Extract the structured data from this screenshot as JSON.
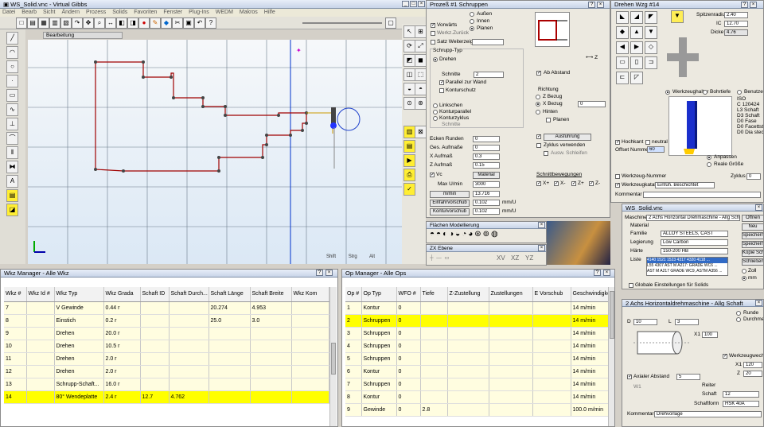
{
  "app": {
    "title": "WS_Solid.vnc - Virtual Gibbs"
  },
  "menu": [
    "Datei",
    "Bearb",
    "Sicht",
    "Ändern",
    "Prozess",
    "Solids",
    "Favoriten",
    "Fenster",
    "Plug-Ins",
    "WEDM",
    "Makros",
    "Hilfe"
  ],
  "viewport": {
    "tab": "Bearbeitung",
    "footer": [
      "Shift",
      "Strg",
      "Alt"
    ]
  },
  "process": {
    "title": "Prozeß #1 Schruppen",
    "options_top": [
      "Vorwärts",
      "Werkz.Zurück",
      "Satz Weiterzeigung"
    ],
    "outer_inner": [
      "Außen",
      "Innen",
      "Planen"
    ],
    "group_title": "Schrupp-Typ",
    "typ": "Drehen",
    "schnitte_label": "Schnitte",
    "schnitte": "2",
    "profile_check": "Parallel zur Wand",
    "kontur_check": "Konturschutz",
    "lists": [
      "Linkschen",
      "Konturparallel",
      "Konturzyklus"
    ],
    "schnitte2": "Schnitte",
    "abstand_label": "Ab Abstand",
    "richtung": "Richtung",
    "richtung_opts": [
      "Z Bezug",
      "X Bezug"
    ],
    "fixiert_label": "Fixiert bei",
    "fixiert": "0",
    "hinter": "Hinten",
    "planen": "Planen",
    "ecken_label": "Ecken Runden",
    "ecken": "0",
    "aufmass_label": "Ges. Aufmaße",
    "aufmass": "0",
    "x_aufmass_label": "X Aufmaß",
    "x_aufmass": "0.3",
    "z_aufmass_label": "Z Aufmaß",
    "z_aufmass": "0.15",
    "vc_label": "Vc",
    "material_btn": "Material",
    "max_label": "Max U/min",
    "max_val": "3000",
    "rpm_btn": "m/min",
    "rpm_val": "13.716",
    "einfahr_btn": "Einfahrvorschub",
    "einfahr_val": "0.102",
    "einfahr_unit": "mm/U",
    "kontur_btn": "Konturvorschub",
    "kontur_val": "0.102",
    "kontur_unit": "mm/U",
    "ausfahr_label": "Ausführung",
    "checks_right": [
      "Zyklus verwenden",
      "Ausw. Schleifen"
    ],
    "schnitt_opts": "Schnittbewegungen",
    "bottom_checks": [
      "X+",
      "X-",
      "Z+",
      "Z-"
    ]
  },
  "dreh": {
    "title": "Drehen Wzg #14",
    "spitzen_label": "Spitzenradius",
    "spitzen": "2.40",
    "ic_label": "IC",
    "ic": "12.70",
    "dicke_label": "Dicke",
    "dicke": "4.76",
    "opts": [
      "Werkzeughalter",
      "Bohrtiefe",
      "Benutzer"
    ],
    "info": [
      "ISO",
      "C 120424",
      "L3 Schaft",
      "D3 Schaft",
      "D0 Fase",
      "D0 Facettstahl",
      "D0 Dia steck"
    ],
    "check1": "Hochkant",
    "check2": "neutral",
    "offset_label": "Offset Nummer",
    "offset": "60",
    "anpassen": "Anpassen",
    "real": "Reale Größe",
    "wkz_label": "Werkzeug-Nummer",
    "zyklus": "Zyklus",
    "zyklus_val": "0",
    "kat_label": "Werkzeugkatalog",
    "kat_val": "Einfüh. Beschichtet",
    "kommentar": "Kommentar"
  },
  "surface": {
    "title": "Flächen Modellierung"
  },
  "zx": {
    "title": "ZX Ebene",
    "axes": [
      "XV",
      "XZ",
      "YZ"
    ]
  },
  "ws": {
    "title": "WS_Solid.vnc",
    "maschine_label": "Maschine",
    "maschine": "2 Achs Horizontal Drehmaschine - Allg Schaft",
    "material_label": "Material",
    "familie_label": "Familie",
    "familie": "ALLOY STEELS, CAST",
    "legierung_label": "Legierung",
    "legierung": "Low Carbon",
    "haerte_label": "Härte",
    "haerte": "150-200 HB",
    "liste_label": "Liste",
    "liste": [
      "4140 1521 1523 4317 4320 4118 ...",
      "L55 4307 AST M A217: GRADE WC6 ...",
      "AST M A217 GRADE WC9, ASTM A356 ..."
    ],
    "zoll": "Zoll",
    "mm": "mm",
    "einst": "Globale Einstellungen für Solids",
    "buttons": [
      "Öffnen",
      "Neu",
      "Speichern",
      "Speichern als",
      "Kopie Schalt...",
      "Schließen"
    ]
  },
  "wkz_manager": {
    "title": "Wkz Manager - Alle Wkz",
    "columns": [
      "Wkz #",
      "Wkz Id #",
      "Wkz Typ",
      "Wkz Grada",
      "Schaft ID",
      "Schaft Durch...",
      "Schaft Länge",
      "Schaft Breite",
      "Wkz Kom"
    ],
    "rows": [
      [
        "7",
        "",
        "V Gewinde",
        "0.44 r",
        "",
        "",
        "20.274",
        "4.953",
        ""
      ],
      [
        "8",
        "",
        "Einstich",
        "0.2 r",
        "",
        "",
        "25.0",
        "3.0",
        ""
      ],
      [
        "9",
        "",
        "Drehen",
        "20.0 r",
        "",
        "",
        "",
        "",
        ""
      ],
      [
        "10",
        "",
        "Drehen",
        "10.5 r",
        "",
        "",
        "",
        "",
        ""
      ],
      [
        "11",
        "",
        "Drehen",
        "2.0 r",
        "",
        "",
        "",
        "",
        ""
      ],
      [
        "12",
        "",
        "Drehen",
        "2.0 r",
        "",
        "",
        "",
        "",
        ""
      ],
      [
        "13",
        "",
        "Schrupp-Schaft...",
        "16.0 r",
        "",
        "",
        "",
        "",
        ""
      ],
      [
        "14",
        "",
        "80° Wendeplatte",
        "2.4 r",
        "12.7",
        "4.762",
        "",
        "",
        ""
      ]
    ]
  },
  "op_manager": {
    "title": "Op Manager - Alle Ops",
    "columns": [
      "Op #",
      "Op Typ",
      "WFO #",
      "Tiefe",
      "Z-Zustellung",
      "Zustellungen",
      "E Vorschub",
      "Geschwindigkeit"
    ],
    "rows": [
      [
        "1",
        "Kontur",
        "0",
        "",
        "",
        "",
        "",
        "14 m/min"
      ],
      [
        "2",
        "Schruppen",
        "0",
        "",
        "",
        "",
        "",
        "14 m/min"
      ],
      [
        "3",
        "Schruppen",
        "0",
        "",
        "",
        "",
        "",
        "14 m/min"
      ],
      [
        "4",
        "Schruppen",
        "0",
        "",
        "",
        "",
        "",
        "14 m/min"
      ],
      [
        "5",
        "Schruppen",
        "0",
        "",
        "",
        "",
        "",
        "14 m/min"
      ],
      [
        "6",
        "Kontur",
        "0",
        "",
        "",
        "",
        "",
        "14 m/min"
      ],
      [
        "7",
        "Schruppen",
        "0",
        "",
        "",
        "",
        "",
        "14 m/min"
      ],
      [
        "8",
        "Kontur",
        "0",
        "",
        "",
        "",
        "",
        "14 m/min"
      ],
      [
        "9",
        "Gewinde",
        "0",
        "2.8",
        "",
        "",
        "",
        "100.0 m/min"
      ]
    ]
  },
  "axial": {
    "title": "2 Achs Horizontaldrehmaschine - Allg Schaft",
    "opts": [
      "Runde",
      "Durchmesser"
    ],
    "d_label": "D",
    "d": "10",
    "l_label": "L",
    "l": "3",
    "x1_label": "X1",
    "x1": "100",
    "wzk_check": "Werkzeugwechsel",
    "x1b": "X1",
    "x1b_val": "120",
    "z_label": "Z",
    "z_val": "20",
    "abstand_check": "Axialer Abstand",
    "abstand": "5",
    "w1_label": "W1",
    "reiter": "Reiter",
    "schaft_label": "Schaft",
    "schaft": "12",
    "schaft2_label": "Schaftform",
    "schaft2": "HSK 40A",
    "kommentar_label": "Kommentar",
    "kommentar": "Drehvorlage"
  },
  "colors": {
    "selected": "#ffff00",
    "row": "#fffde0",
    "path": "#b00000",
    "title": "#c8d4e8"
  }
}
